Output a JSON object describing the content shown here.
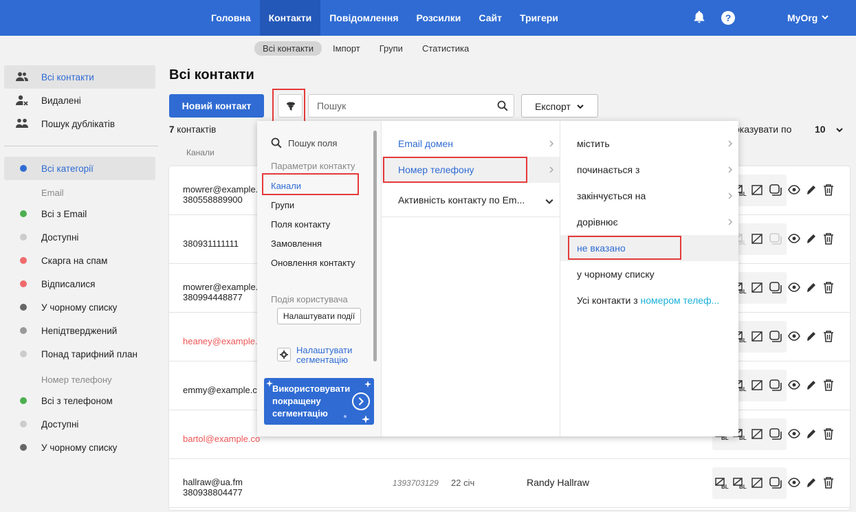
{
  "topnav": {
    "items": [
      "Головна",
      "Контакти",
      "Повідомлення",
      "Розсилки",
      "Сайт",
      "Тригери"
    ],
    "active": 1,
    "org": "MyOrg"
  },
  "subnav": {
    "items": [
      "Всі контакти",
      "Імпорт",
      "Групи",
      "Статистика"
    ],
    "active": 0
  },
  "sidebar": {
    "items": [
      {
        "label": "Всі контакти",
        "icon": "users-icon"
      },
      {
        "label": "Видалені",
        "icon": "user-remove-icon"
      },
      {
        "label": "Пошук дублікатів",
        "icon": "duplicates-icon"
      }
    ],
    "categories": {
      "all": "Всі категорії",
      "email_title": "Email",
      "email": [
        {
          "label": "Всі з Email",
          "color": "#4caf50"
        },
        {
          "label": "Доступні",
          "color": "#cccccc"
        },
        {
          "label": "Скарга на спам",
          "color": "#ef6b6b"
        },
        {
          "label": "Відписалися",
          "color": "#ef6b6b"
        },
        {
          "label": "У чорному списку",
          "color": "#666666"
        },
        {
          "label": "Непідтверджений",
          "color": "#999999"
        },
        {
          "label": "Понад тарифний план",
          "color": "#cccccc"
        }
      ],
      "phone_title": "Номер телефону",
      "phone": [
        {
          "label": "Всі з телефоном",
          "color": "#4caf50"
        },
        {
          "label": "Доступні",
          "color": "#cccccc"
        },
        {
          "label": "У чорному списку",
          "color": "#666666"
        }
      ]
    }
  },
  "main": {
    "title": "Всі контакти",
    "new_contact": "Новий контакт",
    "search_placeholder": "Пошук",
    "export": "Експорт",
    "count_num": "7",
    "count_label": " контактів",
    "show_by": "оказувати по",
    "show_value": "10",
    "channels_header": "Канали"
  },
  "rows": [
    {
      "line1": "mowrer@example.",
      "line2": "380558889900",
      "red": false
    },
    {
      "line1": "380931111111",
      "line2": "",
      "red": false
    },
    {
      "line1": "mowrer@example.",
      "line2": "380994448877",
      "red": false
    },
    {
      "line1": "heaney@example.c",
      "line2": "",
      "red": true
    },
    {
      "line1": "emmy@example.co",
      "line2": "",
      "red": false
    },
    {
      "line1": "bartol@example.co",
      "line2": "",
      "red": true
    },
    {
      "line1": "hallraw@ua.fm",
      "line2": "380938804477",
      "red": false,
      "num": "1393703129",
      "date": "22 січ",
      "name": "Randy Hallraw"
    }
  ],
  "filter": {
    "col1": {
      "search_field": "Пошук поля",
      "contact_params": "Параметри контакту",
      "items": [
        "Канали",
        "Групи",
        "Поля контакту",
        "Замовлення",
        "Оновлення контакту"
      ],
      "user_events": "Подія користувача",
      "configure_events": "Налаштувати події",
      "configure_segmentation": "Налаштувати сегментацію",
      "promo": "Використовувати покращену сегментацію"
    },
    "col2": {
      "items": [
        "Email домен",
        "Номер телефону",
        "Активність контакту по Em..."
      ]
    },
    "col3": {
      "items": [
        "містить",
        "починається з",
        "закінчується на",
        "дорівнює",
        "не вказано",
        "у чорному списку"
      ],
      "all_prefix": "Усі контакти з ",
      "all_link": "номером телеф..."
    }
  }
}
